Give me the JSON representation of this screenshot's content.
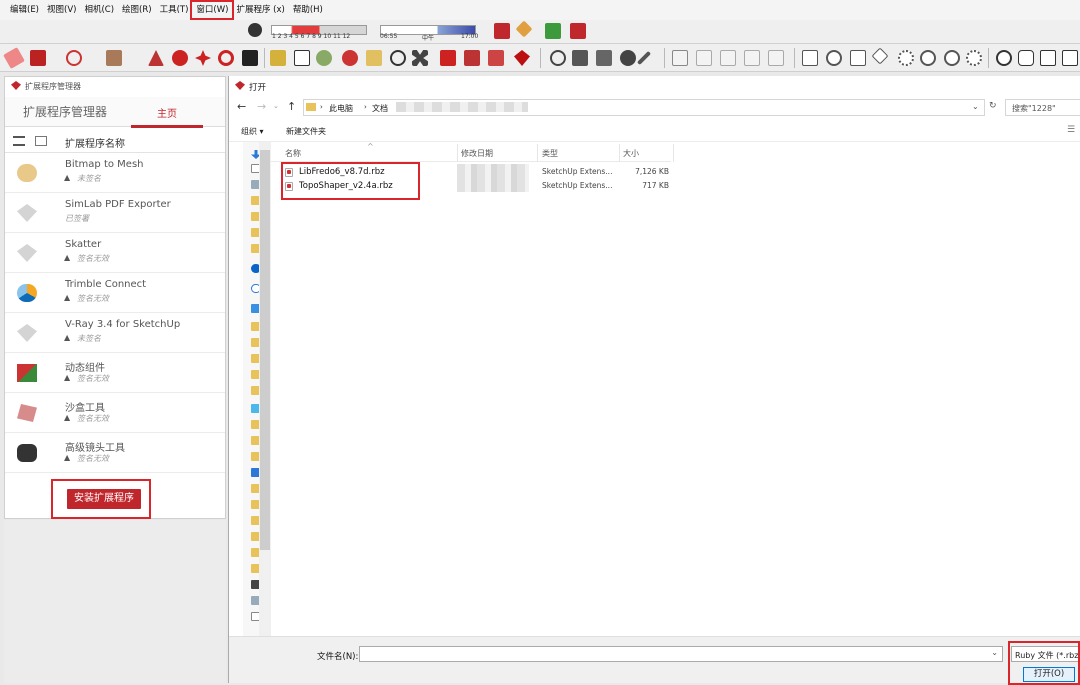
{
  "menu": [
    {
      "label": "编辑(E)"
    },
    {
      "label": "视图(V)"
    },
    {
      "label": "相机(C)"
    },
    {
      "label": "绘图(R)"
    },
    {
      "label": "工具(T)"
    },
    {
      "label": "窗口(W)",
      "highlighted": true
    },
    {
      "label": "扩展程序 (x)"
    },
    {
      "label": "帮助(H)"
    }
  ],
  "shadow": {
    "months": "1 2 3 4 5 6 7 8 9 10 11 12",
    "time_start": "06:55",
    "time_mid": "中午",
    "time_end": "17:00"
  },
  "left_panel": {
    "title": "扩展程序管理器",
    "tabs": [
      {
        "label": "扩展程序管理器"
      },
      {
        "label": "主页"
      }
    ],
    "column_header": "扩展程序名称",
    "extensions": [
      {
        "name": "Bitmap to Mesh",
        "status": "未签名",
        "warn": true,
        "icon": "bitmap-mesh-icon"
      },
      {
        "name": "SimLab PDF Exporter",
        "status": "已签署",
        "warn": false,
        "icon": "simlab-icon"
      },
      {
        "name": "Skatter",
        "status": "签名无效",
        "warn": true,
        "icon": "skatter-icon"
      },
      {
        "name": "Trimble Connect",
        "status": "签名无效",
        "warn": true,
        "icon": "trimble-icon"
      },
      {
        "name": "V-Ray 3.4 for SketchUp",
        "status": "未签名",
        "warn": true,
        "icon": "vray-icon"
      },
      {
        "name": "动态组件",
        "status": "签名无效",
        "warn": true,
        "icon": "dynamic-component-icon"
      },
      {
        "name": "沙盒工具",
        "status": "签名无效",
        "warn": true,
        "icon": "sandbox-icon"
      },
      {
        "name": "高级镜头工具",
        "status": "签名无效",
        "warn": true,
        "icon": "camera-tools-icon"
      }
    ],
    "install_button": "安装扩展程序"
  },
  "dialog": {
    "title": "打开",
    "breadcrumb": [
      "此电脑",
      "文档"
    ],
    "search_placeholder": "搜索\"1228\"",
    "organize": "组织 ▾",
    "new_folder": "新建文件夹",
    "columns": {
      "name": "名称",
      "date": "修改日期",
      "type": "类型",
      "size": "大小"
    },
    "files": [
      {
        "name": "LibFredo6_v8.7d.rbz",
        "type": "SketchUp Extens...",
        "size": "7,126 KB"
      },
      {
        "name": "TopoShaper_v2.4a.rbz",
        "type": "SketchUp Extens...",
        "size": "717 KB"
      }
    ],
    "filename_label": "文件名(N):",
    "filetype": "Ruby 文件 (*.rbz)",
    "open_button": "打开(O)"
  }
}
